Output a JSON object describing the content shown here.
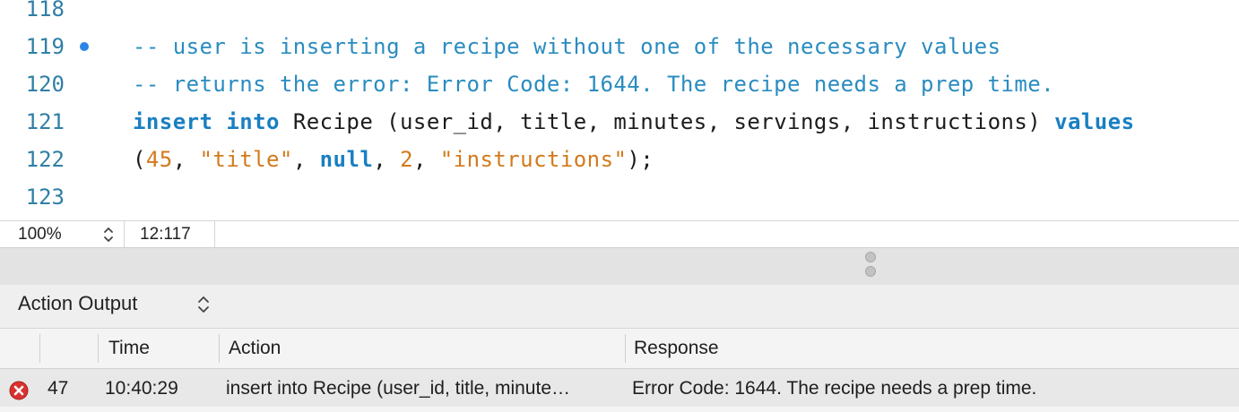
{
  "editor": {
    "lines": [
      {
        "number": "118"
      },
      {
        "number": "119",
        "comment": "-- user is inserting a recipe without one of the necessary values"
      },
      {
        "number": "120",
        "comment": "-- returns the error: Error Code: 1644. The recipe needs a prep time."
      },
      {
        "number": "121",
        "kw_insert": "insert",
        "kw_into": "into",
        "table_and_columns": " Recipe (user_id, title, minutes, servings, instructions) ",
        "kw_values": "values"
      },
      {
        "number": "122",
        "open_paren": "(",
        "num_user_id": "45",
        "sep1": ", ",
        "str_title": "\"title\"",
        "sep2": ", ",
        "kw_null": "null",
        "sep3": ", ",
        "num_servings": "2",
        "sep4": ", ",
        "str_instructions": "\"instructions\"",
        "close": ");"
      },
      {
        "number": "123"
      }
    ]
  },
  "statusbar": {
    "zoom": "100%",
    "cursor_position": "12:117"
  },
  "output": {
    "panel_title": "Action Output",
    "columns": [
      "",
      "",
      "Time",
      "Action",
      "Response"
    ],
    "rows": [
      {
        "status_icon": "error-icon",
        "index": "47",
        "time": "10:40:29",
        "action": "insert into Recipe (user_id, title, minute…",
        "response": "Error Code: 1644. The recipe needs a prep time."
      }
    ]
  },
  "colors": {
    "comment": "#2a8cc0",
    "keyword": "#1a7fc2",
    "literal": "#d27a1c",
    "line_number": "#2f7fa6",
    "marker": "#2a86e6",
    "error": "#d9322e"
  }
}
